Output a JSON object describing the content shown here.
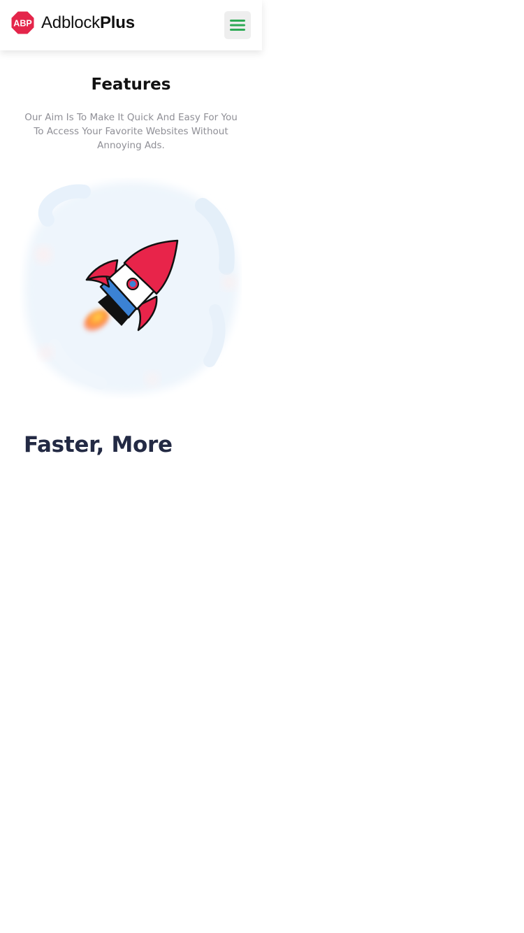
{
  "header": {
    "logo": {
      "badge_text": "ABP",
      "name_regular": "Adblock",
      "name_bold": "Plus",
      "badge_color": "#e4254a"
    },
    "menu_icon": "hamburger-icon",
    "menu_icon_color": "#2eaa55"
  },
  "features": {
    "title": "Features",
    "description": "Our Aim Is To Make It Quick And Easy For You To Access Your Favorite Websites Without Annoying Ads."
  },
  "illustration": {
    "icon": "rocket-icon",
    "rocket_colors": {
      "body": "#e8244a",
      "stripe": "#3b82d4",
      "window": "#ffffff",
      "flame": "#ff9a3c"
    },
    "backdrop_color": "#eef5fc"
  },
  "section": {
    "heading": "Faster, More"
  }
}
